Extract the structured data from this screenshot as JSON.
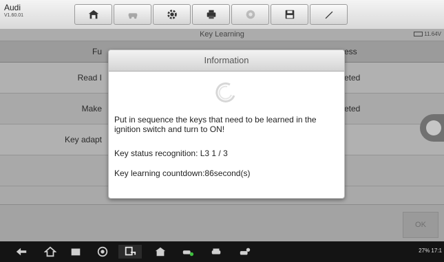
{
  "brand": {
    "name": "Audi",
    "version": "V1.60.01"
  },
  "toolbar": {
    "buttons": [
      "home-icon",
      "vehicle-icon",
      "settings-icon",
      "print-icon",
      "help-icon",
      "save-icon",
      "edit-icon"
    ]
  },
  "header": {
    "title": "Key Learning",
    "voltage": "11.64V"
  },
  "table": {
    "header_left": "Fu",
    "header_right": "ess",
    "rows": [
      {
        "left": "Read I",
        "right": "eted"
      },
      {
        "left": "Make",
        "right": "eted"
      },
      {
        "left": "Key adapt",
        "right": ""
      },
      {
        "left": "",
        "right": ""
      }
    ]
  },
  "footer": {
    "ok_label": "OK"
  },
  "dialog": {
    "title": "Information",
    "message": "Put in sequence the keys that need to be learned in the ignition switch and turn to ON!",
    "status_line": "Key status recognition: L3  1 / 3",
    "countdown_line": "Key learning countdown:86second(s)"
  },
  "statusbar": {
    "battery": "27%",
    "time": "17:1"
  }
}
